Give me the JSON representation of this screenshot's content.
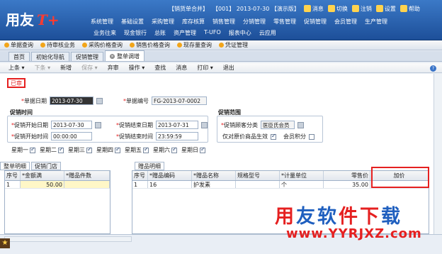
{
  "header": {
    "logo": "用友",
    "logo_mark": "T+",
    "top_bar": [
      {
        "label": "【销货单合并】",
        "icon": ""
      },
      {
        "label": "【001】 2013-07-30 【演示版】",
        "icon": ""
      },
      {
        "label": "消息",
        "icon": "message-icon"
      },
      {
        "label": "切换",
        "icon": "switch-icon"
      },
      {
        "label": "注销",
        "icon": "logout-icon"
      },
      {
        "label": "设置",
        "icon": "gear-icon"
      },
      {
        "label": "帮助",
        "icon": "help-icon"
      }
    ],
    "nav_row1": [
      "系统管理",
      "基础设置",
      "采购管理",
      "库存核算",
      "销售管理",
      "分销管理",
      "零售管理",
      "促销管理",
      "会员管理",
      "生产管理"
    ],
    "nav_row2": [
      "业务往来",
      "现金银行",
      "总账",
      "资产管理",
      "T-UFO",
      "报表中心",
      "云应用"
    ]
  },
  "quicklinks": [
    "单据查询",
    "待审核业务",
    "采购价格查询",
    "销售价格查询",
    "现存量查询",
    "凭证管理"
  ],
  "tabs": [
    {
      "label": "首页",
      "active": false
    },
    {
      "label": "初始化导航",
      "active": false
    },
    {
      "label": "促销管理",
      "active": false
    },
    {
      "label": "整单调增",
      "active": true
    }
  ],
  "toolbar": {
    "items": [
      {
        "label": "上条 ▾",
        "disabled": false
      },
      {
        "label": "下条 ▾",
        "disabled": true
      },
      {
        "label": "新增",
        "disabled": false
      },
      {
        "label": "保存 ▾",
        "disabled": true
      },
      {
        "label": "弃审",
        "disabled": false
      },
      {
        "label": "操作 ▾",
        "disabled": false
      },
      {
        "label": "查找",
        "disabled": false
      },
      {
        "label": "消息",
        "disabled": false
      },
      {
        "label": "打印 ▾",
        "disabled": false
      },
      {
        "label": "退出",
        "disabled": false
      }
    ]
  },
  "form": {
    "status": "已审",
    "doc_date_label": "单据日期",
    "doc_date": "2013-07-30",
    "doc_no_label": "单据编号",
    "doc_no": "FG-2013-07-0002",
    "promo_time_title": "促销时间",
    "start_date_label": "促销开始日期",
    "start_date": "2013-07-30",
    "end_date_label": "促销结束日期",
    "end_date": "2013-07-31",
    "start_time_label": "促销开始时间",
    "start_time": "00:00:00",
    "end_time_label": "促销结束时间",
    "end_time": "23:59:59",
    "promo_scope_title": "促销范围",
    "customer_class_label": "促销顾客分类",
    "customer_class": "医臣氏会员",
    "only_original_label": "仅对原价商品生效",
    "member_points_label": "会员积分",
    "weekdays": [
      {
        "label": "星期一",
        "checked": true
      },
      {
        "label": "星期二",
        "checked": true
      },
      {
        "label": "星期三",
        "checked": true
      },
      {
        "label": "星期四",
        "checked": true
      },
      {
        "label": "星期五",
        "checked": true
      },
      {
        "label": "星期六",
        "checked": true
      },
      {
        "label": "星期日",
        "checked": true
      }
    ]
  },
  "left_panel": {
    "tabs": [
      "整单明细",
      "促销门店"
    ],
    "headers": [
      "序号",
      "*金额满",
      "*赠品件数"
    ],
    "rows": [
      {
        "no": "1",
        "amount": "50.00",
        "qty": ""
      }
    ]
  },
  "right_panel": {
    "title": "赠品明细",
    "headers": [
      "序号",
      "*赠品编码",
      "*赠品名称",
      "规格型号",
      "*计量单位",
      "零售价",
      "加价"
    ],
    "rows": [
      {
        "no": "1",
        "code": "16",
        "name": "护发素",
        "spec": "",
        "unit": "个",
        "price": "35.00",
        "markup": ""
      }
    ]
  },
  "watermark": {
    "text": "用友软件下载",
    "url": "www.YYRJXZ.com"
  }
}
